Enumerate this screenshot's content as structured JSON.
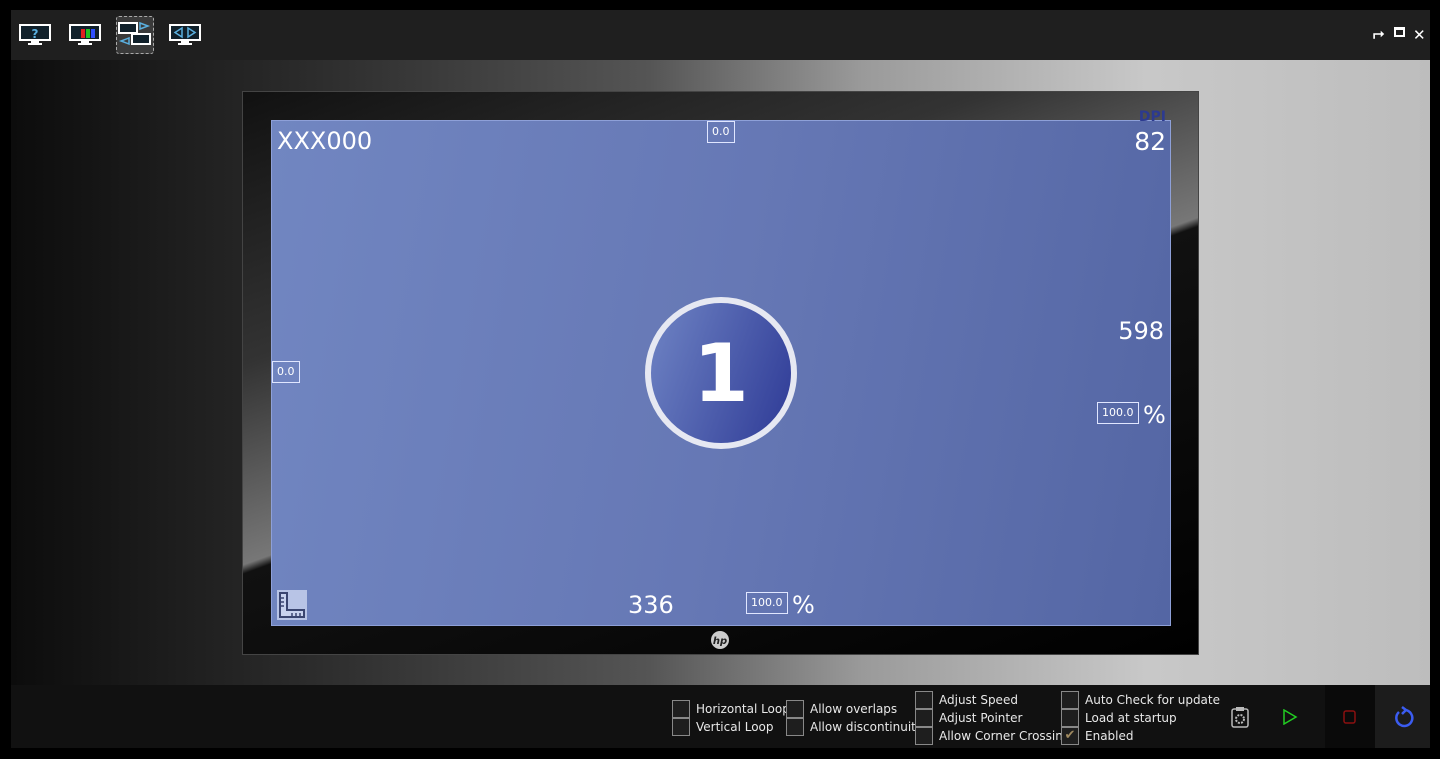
{
  "toolbar": {
    "buttons": [
      {
        "icon": "help-monitor-icon"
      },
      {
        "icon": "color-monitor-icon"
      },
      {
        "icon": "dual-monitor-swap-icon",
        "selected": true
      },
      {
        "icon": "monitor-arrows-icon"
      }
    ],
    "window_controls": {
      "pin": "pin-icon",
      "maximize": "maximize-icon",
      "close": "close-icon"
    }
  },
  "monitor": {
    "brand": "hp",
    "name": "XXX000",
    "top_offset": "0.0",
    "left_offset": "0.0",
    "dpi_label": "DPI",
    "dpi": "82",
    "height_px": "598",
    "height_scale": "100.0",
    "width_px": "336",
    "width_scale": "100.0",
    "percent": "%",
    "number": "1"
  },
  "options": [
    {
      "label": "Horizontal Loop",
      "checked": false
    },
    {
      "label": "Vertical Loop",
      "checked": false
    },
    {
      "label": "Allow overlaps",
      "checked": false
    },
    {
      "label": "Allow discontinuity",
      "checked": false
    },
    {
      "label": "Adjust Speed",
      "checked": false
    },
    {
      "label": "Adjust Pointer",
      "checked": false
    },
    {
      "label": "Allow Corner Crossing",
      "checked": false
    },
    {
      "label": "Auto Check for update",
      "checked": false
    },
    {
      "label": "Load at startup",
      "checked": false
    },
    {
      "label": "Enabled",
      "checked": true
    }
  ],
  "actions": {
    "settings": "clipboard-gear-icon",
    "start": "play-icon",
    "stop": "stop-icon",
    "reload": "reload-icon"
  },
  "colors": {
    "screen": "#6678b5",
    "play": "#22cc22",
    "stop": "#8a1010",
    "reload": "#3b5cf0"
  }
}
